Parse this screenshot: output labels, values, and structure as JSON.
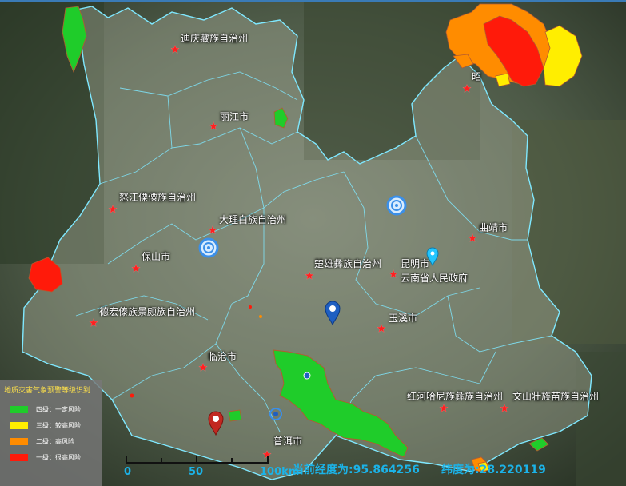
{
  "prefectures": [
    {
      "name": "迪庆藏族自治州"
    },
    {
      "name": "丽江市"
    },
    {
      "name": "怒江傈僳族自治州"
    },
    {
      "name": "大理白族自治州"
    },
    {
      "name": "保山市"
    },
    {
      "name": "楚雄彝族自治州"
    },
    {
      "name": "昆明市"
    },
    {
      "name": "云南省人民政府"
    },
    {
      "name": "曲靖市"
    },
    {
      "name": "德宏傣族景颇族自治州"
    },
    {
      "name": "玉溪市"
    },
    {
      "name": "临沧市"
    },
    {
      "name": "红河哈尼族彝族自治州"
    },
    {
      "name": "文山壮族苗族自治州"
    },
    {
      "name": "普洱市"
    },
    {
      "name": "昭"
    }
  ],
  "legend": {
    "title": "地质灾害气象预警等级识别",
    "items": [
      {
        "label": "四级：一定风险",
        "color": "#1fcc2a"
      },
      {
        "label": "三级：较高风险",
        "color": "#ffee00"
      },
      {
        "label": "二级：高风险",
        "color": "#ff8c00"
      },
      {
        "label": "一级：很高风险",
        "color": "#ff1a0a"
      }
    ]
  },
  "scale": {
    "ticks": [
      "0",
      "50",
      "100km"
    ]
  },
  "coordinates": {
    "lon_label": "当前经度为:95.864256",
    "lat_label": "纬度为:28.220119"
  },
  "colors": {
    "boundary": "#7fe8ff",
    "star": "#ff2020",
    "scale_text": "#1bb3e8"
  },
  "markers": [
    {
      "icon": "target-marker-icon"
    },
    {
      "icon": "target-marker-icon"
    },
    {
      "icon": "blue-map-pin-icon"
    },
    {
      "icon": "red-map-pin-icon"
    },
    {
      "icon": "light-blue-map-pin-icon"
    }
  ]
}
